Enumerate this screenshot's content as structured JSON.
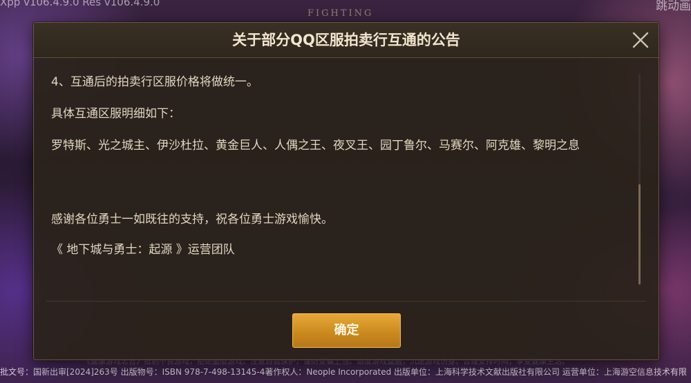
{
  "background": {
    "version_text": "Xpp v106.4.9.0 Res v106.4.9.0",
    "fighting_text": "FIGHTING",
    "skip_text": "跳动画",
    "footer_text": "批文号：国新出审[2024]263号 出版物号：ISBN 978-7-498-13145-4著作权人：Neople Incorporated 出版单位：上海科学技术文献出版社有限公司 运营单位：上海游空信息技术有限",
    "warning_text": "《健康游戏忠告》抵制不良游戏，拒绝盗版游戏。注意自我保护，谨防受骗上当。适度游戏益脑，沉迷游戏伤身。合理安排时间，享受健康生活。"
  },
  "dialog": {
    "title": "关于部分QQ区服拍卖行互通的公告",
    "close_icon": "close-icon",
    "paragraphs": [
      "4、互通后的拍卖行区服价格将做统一。",
      "具体互通区服明细如下：",
      "罗特斯、光之城主、伊沙杜拉、黄金巨人、人偶之王、夜叉王、园丁鲁尔、马赛尔、阿克雄、黎明之息",
      "感谢各位勇士一如既往的支持，祝各位勇士游戏愉快。",
      "《 地下城与勇士：起源 》运营团队"
    ],
    "confirm_label": "确定"
  },
  "colors": {
    "accent_button": "#d4921f",
    "dialog_bg": "#2a221a",
    "title_text": "#f2e6cf",
    "body_text": "#e2d6c0"
  }
}
